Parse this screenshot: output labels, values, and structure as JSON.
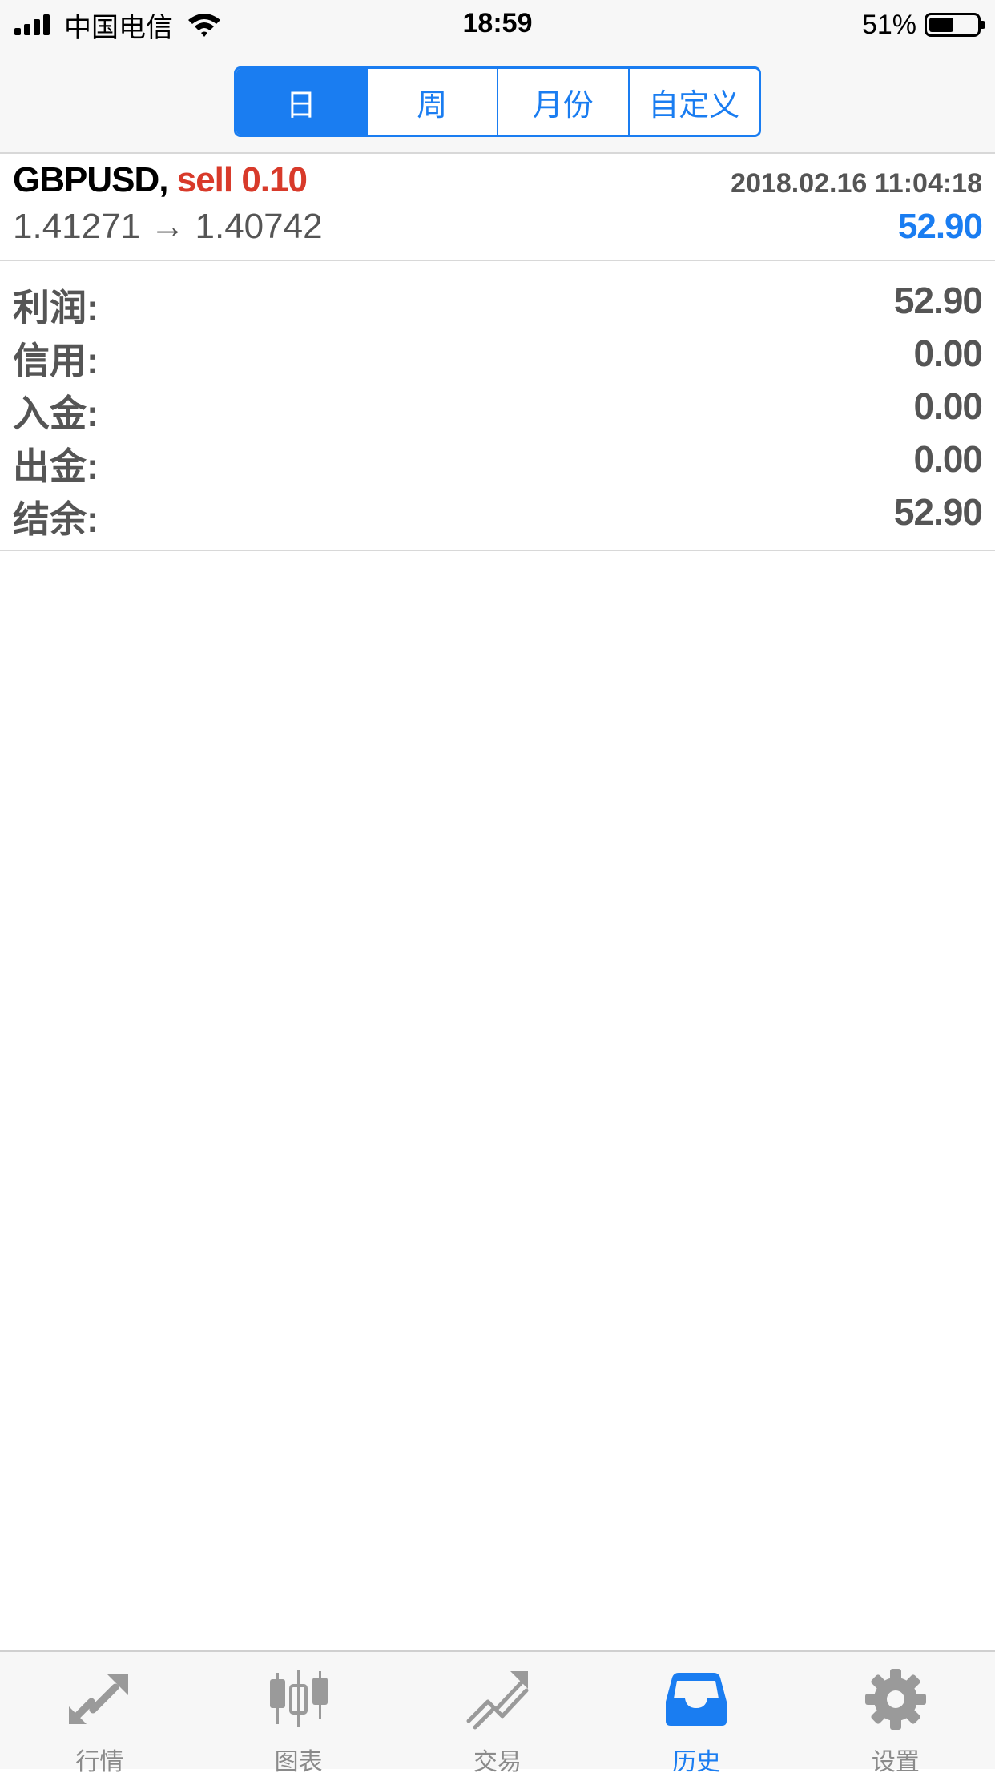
{
  "status_bar": {
    "carrier": "中国电信",
    "time": "18:59",
    "battery": "51%",
    "battery_level": 0.51
  },
  "period_tabs": [
    {
      "label": "日",
      "active": true
    },
    {
      "label": "周",
      "active": false
    },
    {
      "label": "月份",
      "active": false
    },
    {
      "label": "自定义",
      "active": false
    }
  ],
  "deal": {
    "symbol": "GBPUSD,",
    "side": "sell 0.10",
    "datetime": "2018.02.16 11:04:18",
    "prices": "1.41271 → 1.40742",
    "profit": "52.90"
  },
  "summary": [
    {
      "label": "利润:",
      "value": "52.90"
    },
    {
      "label": "信用:",
      "value": "0.00"
    },
    {
      "label": "入金:",
      "value": "0.00"
    },
    {
      "label": "出金:",
      "value": "0.00"
    },
    {
      "label": "结余:",
      "value": "52.90"
    }
  ],
  "tabbar": [
    {
      "label": "行情",
      "icon": "quotes-arrows-icon",
      "active": false
    },
    {
      "label": "图表",
      "icon": "candlestick-chart-icon",
      "active": false
    },
    {
      "label": "交易",
      "icon": "trade-trend-icon",
      "active": false
    },
    {
      "label": "历史",
      "icon": "history-inbox-icon",
      "active": true
    },
    {
      "label": "设置",
      "icon": "gear-icon",
      "active": false
    }
  ],
  "colors": {
    "accent": "#1a7df1",
    "sell": "#d83a2a",
    "inactive_icon": "#9a9a9a",
    "text_gray": "#555555"
  }
}
